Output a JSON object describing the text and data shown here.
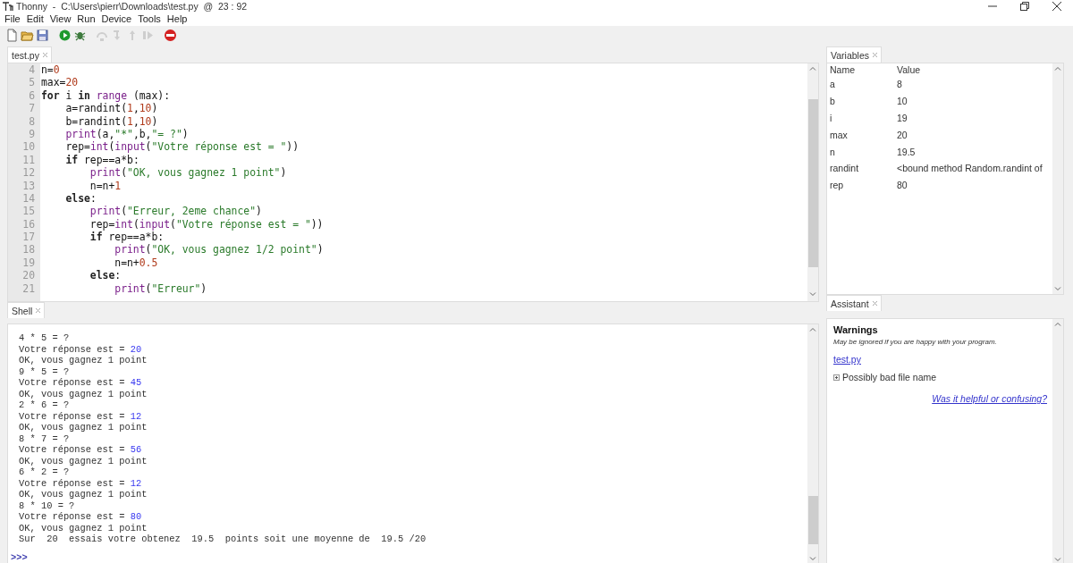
{
  "window": {
    "title": "Thonny  -  C:\\Users\\pierr\\Downloads\\test.py  @  23 : 92"
  },
  "menu": [
    "File",
    "Edit",
    "View",
    "Run",
    "Device",
    "Tools",
    "Help"
  ],
  "toolbar": [
    {
      "kind": "new",
      "disabled": false
    },
    {
      "kind": "open",
      "disabled": false
    },
    {
      "kind": "save",
      "disabled": false
    },
    {
      "kind": "run",
      "disabled": false
    },
    {
      "kind": "debug",
      "disabled": false
    },
    {
      "kind": "step_over",
      "disabled": true
    },
    {
      "kind": "step_into",
      "disabled": true
    },
    {
      "kind": "step_out",
      "disabled": true
    },
    {
      "kind": "resume",
      "disabled": true
    },
    {
      "kind": "stop",
      "disabled": false
    }
  ],
  "editor": {
    "tab": {
      "label": "test.py",
      "selected": true
    },
    "lines": [
      {
        "number": "4",
        "tokens": [
          {
            "text": "n=",
            "kind": "plain"
          },
          {
            "text": "0",
            "kind": "num"
          }
        ]
      },
      {
        "number": "5",
        "tokens": [
          {
            "text": "max=",
            "kind": "plain"
          },
          {
            "text": "20",
            "kind": "num"
          }
        ]
      },
      {
        "number": "6",
        "tokens": [
          {
            "text": "for",
            "kind": "kw"
          },
          {
            "text": " i ",
            "kind": "plain"
          },
          {
            "text": "in",
            "kind": "kw"
          },
          {
            "text": " range",
            "kind": "builtin"
          },
          {
            "text": " (max):",
            "kind": "plain"
          }
        ]
      },
      {
        "number": "7",
        "tokens": [
          {
            "text": "    a=randint(",
            "kind": "plain"
          },
          {
            "text": "1",
            "kind": "num"
          },
          {
            "text": ",",
            "kind": "plain"
          },
          {
            "text": "10",
            "kind": "num"
          },
          {
            "text": ")",
            "kind": "plain"
          }
        ]
      },
      {
        "number": "8",
        "tokens": [
          {
            "text": "    b=randint(",
            "kind": "plain"
          },
          {
            "text": "1",
            "kind": "num"
          },
          {
            "text": ",",
            "kind": "plain"
          },
          {
            "text": "10",
            "kind": "num"
          },
          {
            "text": ")",
            "kind": "plain"
          }
        ]
      },
      {
        "number": "9",
        "tokens": [
          {
            "text": "    print",
            "kind": "builtin"
          },
          {
            "text": "(a,",
            "kind": "plain"
          },
          {
            "text": "\"*\"",
            "kind": "str"
          },
          {
            "text": ",b,",
            "kind": "plain"
          },
          {
            "text": "\"= ?\"",
            "kind": "str"
          },
          {
            "text": ")",
            "kind": "plain"
          }
        ]
      },
      {
        "number": "10",
        "tokens": [
          {
            "text": "    rep=",
            "kind": "plain"
          },
          {
            "text": "int",
            "kind": "builtin"
          },
          {
            "text": "(",
            "kind": "plain"
          },
          {
            "text": "input",
            "kind": "builtin"
          },
          {
            "text": "(",
            "kind": "plain"
          },
          {
            "text": "\"Votre réponse est = \"",
            "kind": "str"
          },
          {
            "text": "))",
            "kind": "plain"
          }
        ]
      },
      {
        "number": "11",
        "tokens": [
          {
            "text": "    if",
            "kind": "kw"
          },
          {
            "text": " rep==a*b:",
            "kind": "plain"
          }
        ]
      },
      {
        "number": "12",
        "tokens": [
          {
            "text": "        print",
            "kind": "builtin"
          },
          {
            "text": "(",
            "kind": "plain"
          },
          {
            "text": "\"OK, vous gagnez 1 point\"",
            "kind": "str"
          },
          {
            "text": ")",
            "kind": "plain"
          }
        ]
      },
      {
        "number": "13",
        "tokens": [
          {
            "text": "        n=n+",
            "kind": "plain"
          },
          {
            "text": "1",
            "kind": "num"
          }
        ]
      },
      {
        "number": "14",
        "tokens": [
          {
            "text": "    else",
            "kind": "kw"
          },
          {
            "text": ":",
            "kind": "plain"
          }
        ]
      },
      {
        "number": "15",
        "tokens": [
          {
            "text": "        print",
            "kind": "builtin"
          },
          {
            "text": "(",
            "kind": "plain"
          },
          {
            "text": "\"Erreur, 2eme chance\"",
            "kind": "str"
          },
          {
            "text": ")",
            "kind": "plain"
          }
        ]
      },
      {
        "number": "16",
        "tokens": [
          {
            "text": "        rep=",
            "kind": "plain"
          },
          {
            "text": "int",
            "kind": "builtin"
          },
          {
            "text": "(",
            "kind": "plain"
          },
          {
            "text": "input",
            "kind": "builtin"
          },
          {
            "text": "(",
            "kind": "plain"
          },
          {
            "text": "\"Votre réponse est = \"",
            "kind": "str"
          },
          {
            "text": "))",
            "kind": "plain"
          }
        ]
      },
      {
        "number": "17",
        "tokens": [
          {
            "text": "        if",
            "kind": "kw"
          },
          {
            "text": " rep==a*b:",
            "kind": "plain"
          }
        ]
      },
      {
        "number": "18",
        "tokens": [
          {
            "text": "            print",
            "kind": "builtin"
          },
          {
            "text": "(",
            "kind": "plain"
          },
          {
            "text": "\"OK, vous gagnez 1/2 point\"",
            "kind": "str"
          },
          {
            "text": ")",
            "kind": "plain"
          }
        ]
      },
      {
        "number": "19",
        "tokens": [
          {
            "text": "            n=n+",
            "kind": "plain"
          },
          {
            "text": "0.5",
            "kind": "num"
          }
        ]
      },
      {
        "number": "20",
        "tokens": [
          {
            "text": "        else",
            "kind": "kw"
          },
          {
            "text": ":",
            "kind": "plain"
          }
        ]
      },
      {
        "number": "21",
        "tokens": [
          {
            "text": "            print",
            "kind": "builtin"
          },
          {
            "text": "(",
            "kind": "plain"
          },
          {
            "text": "\"Erreur\"",
            "kind": "str"
          },
          {
            "text": ")",
            "kind": "plain"
          }
        ]
      }
    ]
  },
  "shell": {
    "tab": {
      "label": "Shell",
      "selected": true
    },
    "lines": [
      {
        "text": "4 * 5 = ?"
      },
      {
        "text": "Votre réponse est = ",
        "input": "20"
      },
      {
        "text": "OK, vous gagnez 1 point"
      },
      {
        "text": "9 * 5 = ?"
      },
      {
        "text": "Votre réponse est = ",
        "input": "45"
      },
      {
        "text": "OK, vous gagnez 1 point"
      },
      {
        "text": "2 * 6 = ?"
      },
      {
        "text": "Votre réponse est = ",
        "input": "12"
      },
      {
        "text": "OK, vous gagnez 1 point"
      },
      {
        "text": "8 * 7 = ?"
      },
      {
        "text": "Votre réponse est = ",
        "input": "56"
      },
      {
        "text": "OK, vous gagnez 1 point"
      },
      {
        "text": "6 * 2 = ?"
      },
      {
        "text": "Votre réponse est = ",
        "input": "12"
      },
      {
        "text": "OK, vous gagnez 1 point"
      },
      {
        "text": "8 * 10 = ?"
      },
      {
        "text": "Votre réponse est = ",
        "input": "80"
      },
      {
        "text": "OK, vous gagnez 1 point"
      },
      {
        "text": "Sur  20  essais votre obtenez  19.5  points soit une moyenne de  19.5 /20"
      }
    ],
    "prompt": ">>>"
  },
  "variables": {
    "tab": {
      "label": "Variables",
      "selected": true
    },
    "columns": [
      "Name",
      "Value"
    ],
    "rows": [
      {
        "name": "a",
        "value": "8"
      },
      {
        "name": "b",
        "value": "10"
      },
      {
        "name": "i",
        "value": "19"
      },
      {
        "name": "max",
        "value": "20"
      },
      {
        "name": "n",
        "value": "19.5"
      },
      {
        "name": "randint",
        "value": "<bound method Random.randint of"
      },
      {
        "name": "rep",
        "value": "80"
      }
    ]
  },
  "assistant": {
    "tab": {
      "label": "Assistant",
      "selected": true
    },
    "heading": "Warnings",
    "note": "May be ignored if you are happy with your program.",
    "file_link": "test.py",
    "items": [
      {
        "text": "Possibly bad file name"
      }
    ],
    "feedback_link": "Was it helpful or confusing?"
  }
}
